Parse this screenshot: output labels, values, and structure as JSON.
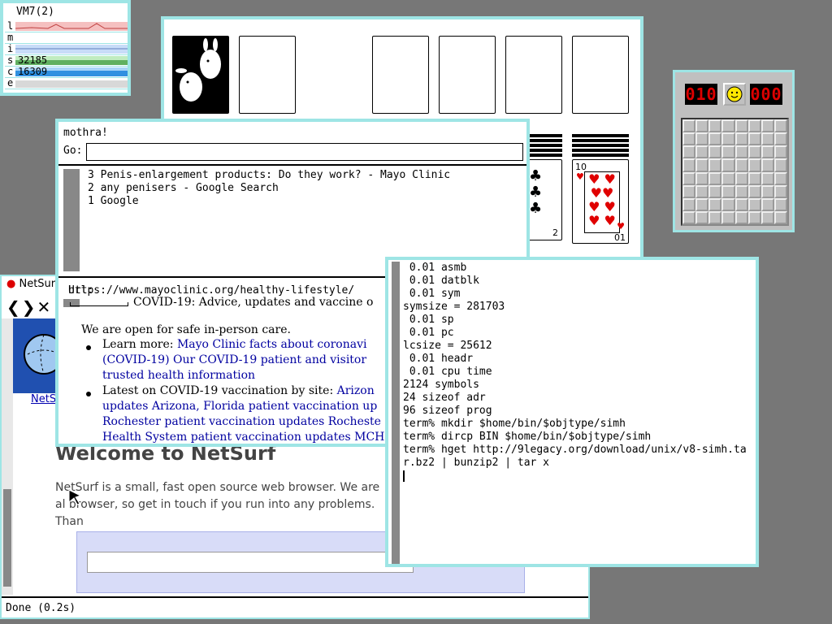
{
  "stats": {
    "title": "VM7(2)",
    "rows": [
      {
        "label": "l",
        "value": "",
        "color": "#f0a0a0"
      },
      {
        "label": "m",
        "value": "",
        "color": "#ffffff"
      },
      {
        "label": "i",
        "value": "",
        "color": "#a0c0f0"
      },
      {
        "label": "s",
        "value": "32185",
        "color": "#a0e0a0"
      },
      {
        "label": "c",
        "value": "16309",
        "color": "#60b0f0"
      },
      {
        "label": "e",
        "value": "",
        "color": "#e0e0e0"
      }
    ]
  },
  "solitaire": {
    "tableau_card1": {
      "rank": "",
      "suit": "♣",
      "corner": "2"
    },
    "tableau_card2": {
      "rank": "10",
      "suit": "♥",
      "corner": "01"
    }
  },
  "minesweeper": {
    "mines_left": "010",
    "timer": "000",
    "face": "☺"
  },
  "netsurf": {
    "title": "NetSurf",
    "nav": "‹›×",
    "tab_link": "NetSu",
    "heading": "Welcome to NetSurf",
    "paragraph": "NetSurf is a small, fast open source web browser. We are al browser, so get in touch if you run into any problems. Than",
    "status": "Done (0.2s)"
  },
  "abaco": {
    "host": "mothra!",
    "go_label": "Go:",
    "go_value": "",
    "history": [
      "3 Penis-enlargement products: Do they work? - Mayo Clinic",
      "2 any penisers - Google Search",
      "1 Google"
    ],
    "url_label": "Url:",
    "url": "https://www.mayoclinic.org/healthy-lifestyle/",
    "page": {
      "covid_header": "COVID-19: Advice, updates and vaccine o",
      "open_line": "We are open for safe in-person care.",
      "learn_prefix": "Learn more: ",
      "learn_link1": "Mayo Clinic facts about coronavi",
      "learn_link2": "(COVID-19) Our COVID-19 patient and visitor",
      "learn_link3": "trusted health information",
      "vacc_prefix": "Latest on COVID-19 vaccination by site: ",
      "vacc_link1": "Arizon",
      "vacc_link2": "updates Arizona, Florida patient vaccination up",
      "vacc_link3": "Rochester patient vaccination updates Rocheste",
      "vacc_link4": "Health System patient vaccination updates MCH"
    }
  },
  "terminal": {
    "lines": [
      " 0.01 asmb",
      " 0.01 datblk",
      " 0.01 sym",
      "symsize = 281703",
      " 0.01 sp",
      " 0.01 pc",
      "lcsize = 25612",
      " 0.01 headr",
      " 0.01 cpu time",
      "2124 symbols",
      "24 sizeof adr",
      "96 sizeof prog",
      "term% mkdir $home/bin/$objtype/simh",
      "term% dircp BIN $home/bin/$objtype/simh",
      "term% hget http://9legacy.org/download/unix/v8-simh.ta",
      "r.bz2 | bunzip2 | tar x"
    ]
  }
}
